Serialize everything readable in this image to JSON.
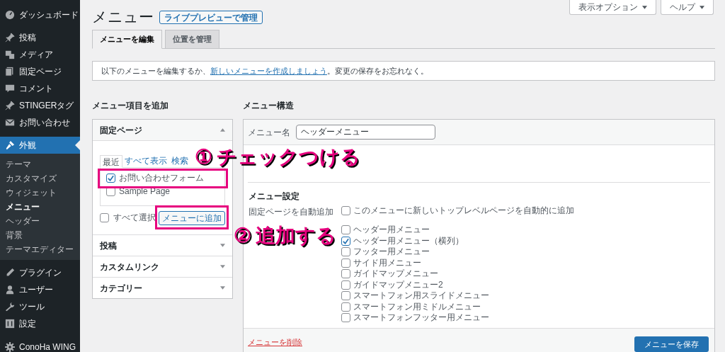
{
  "sidebar": {
    "items": [
      {
        "label": "ダッシュボード",
        "selected": false
      },
      {
        "label": "投稿",
        "selected": false
      },
      {
        "label": "メディア",
        "selected": false
      },
      {
        "label": "固定ページ",
        "selected": false
      },
      {
        "label": "コメント",
        "selected": false
      },
      {
        "label": "STINGERタグ",
        "selected": false
      },
      {
        "label": "お問い合わせ",
        "selected": false
      },
      {
        "label": "外観",
        "selected": true,
        "children": [
          {
            "label": "テーマ",
            "selected": false
          },
          {
            "label": "カスタマイズ",
            "selected": false
          },
          {
            "label": "ウィジェット",
            "selected": false
          },
          {
            "label": "メニュー",
            "selected": true
          },
          {
            "label": "ヘッダー",
            "selected": false
          },
          {
            "label": "背景",
            "selected": false
          },
          {
            "label": "テーマエディター",
            "selected": false
          }
        ]
      },
      {
        "label": "プラグイン",
        "selected": false
      },
      {
        "label": "ユーザー",
        "selected": false
      },
      {
        "label": "ツール",
        "selected": false
      },
      {
        "label": "設定",
        "selected": false
      },
      {
        "label": "ConoHa WING",
        "selected": false
      }
    ]
  },
  "page": {
    "title": "メニュー",
    "action_button": "ライブプレビューで管理"
  },
  "top_buttons": [
    "表示オプション",
    "ヘルプ"
  ],
  "tabs": [
    {
      "label": "メニューを編集",
      "selected": true
    },
    {
      "label": "位置を管理",
      "selected": false
    }
  ],
  "notice": {
    "text_before": "以下のメニューを編集するか、",
    "link": "新しいメニューを作成しましょう",
    "text_after": "。変更の保存をお忘れなく。"
  },
  "add_items": {
    "title": "メニュー項目を追加",
    "sections": [
      {
        "label": "固定ページ",
        "expanded": true,
        "tabs": [
          {
            "label": "最近",
            "selected": true
          },
          {
            "label": "すべて表示",
            "selected": false
          },
          {
            "label": "検索",
            "selected": false
          }
        ],
        "items": [
          {
            "label": "お問い合わせフォーム",
            "checked": true
          },
          {
            "label": "Sample Page",
            "checked": false
          }
        ],
        "select_all": {
          "label": "すべて選択",
          "checked": false
        },
        "add_button": "メニューに追加"
      },
      {
        "label": "投稿",
        "expanded": false
      },
      {
        "label": "カスタムリンク",
        "expanded": false
      },
      {
        "label": "カテゴリー",
        "expanded": false
      }
    ]
  },
  "structure": {
    "title": "メニュー構造",
    "name_label": "メニュー名",
    "name_value": "ヘッダーメニュー",
    "settings_title": "メニュー設定",
    "auto_add_label": "固定ページを自動追加",
    "auto_add_option": {
      "label": "このメニューに新しいトップレベルページを自動的に追加",
      "checked": false
    },
    "locations": [
      {
        "label": "ヘッダー用メニュー",
        "checked": false
      },
      {
        "label": "ヘッダー用メニュー（横列）",
        "checked": true
      },
      {
        "label": "フッター用メニュー",
        "checked": false
      },
      {
        "label": "サイド用メニュー",
        "checked": false
      },
      {
        "label": "ガイドマップメニュー",
        "checked": false
      },
      {
        "label": "ガイドマップメニュー2",
        "checked": false
      },
      {
        "label": "スマートフォン用スライドメニュー",
        "checked": false
      },
      {
        "label": "スマートフォン用ミドルメニュー",
        "checked": false
      },
      {
        "label": "スマートフォンフッター用メニュー",
        "checked": false
      }
    ],
    "delete_link": "メニューを削除",
    "save_button": "メニューを保存"
  },
  "annotations": [
    {
      "number": "①",
      "text": "チェックつける"
    },
    {
      "number": "②",
      "text": "追加する"
    }
  ]
}
